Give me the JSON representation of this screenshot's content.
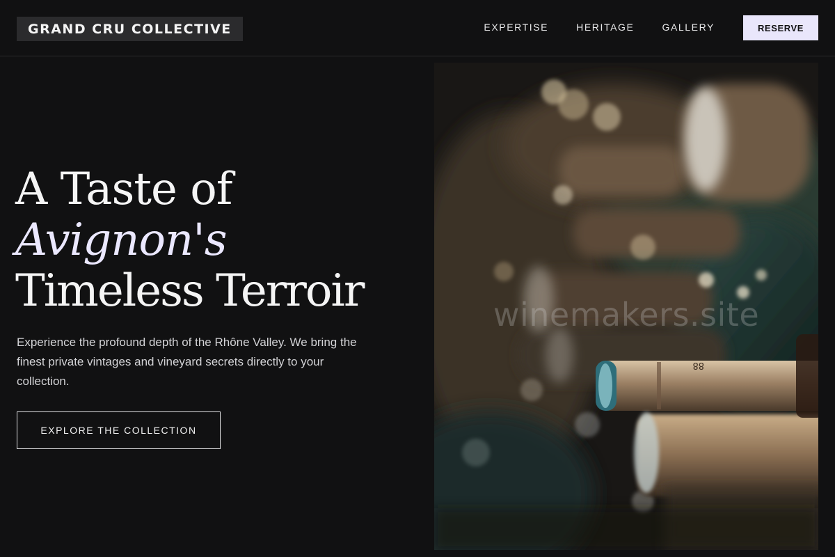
{
  "header": {
    "logo": "GRAND CRU COLLECTIVE",
    "nav": [
      {
        "label": "EXPERTISE"
      },
      {
        "label": "HERITAGE"
      },
      {
        "label": "GALLERY"
      }
    ],
    "cta_label": "RESERVE"
  },
  "hero": {
    "title_line1": "A Taste of",
    "title_line2": "Avignon's",
    "title_line3": "Timeless Terroir",
    "description": "Experience the profound depth of the Rhône Valley. We bring the finest private vintages and vineyard secrets directly to your collection.",
    "button_label": "EXPLORE THE COLLECTION"
  },
  "image": {
    "description": "Wine bottles resting horizontally in a dark cellar rack, shallow depth of field",
    "watermark": "winemakers.site"
  },
  "colors": {
    "background": "#111112",
    "accent": "#e9e6fb",
    "text": "#f5f5f5"
  }
}
